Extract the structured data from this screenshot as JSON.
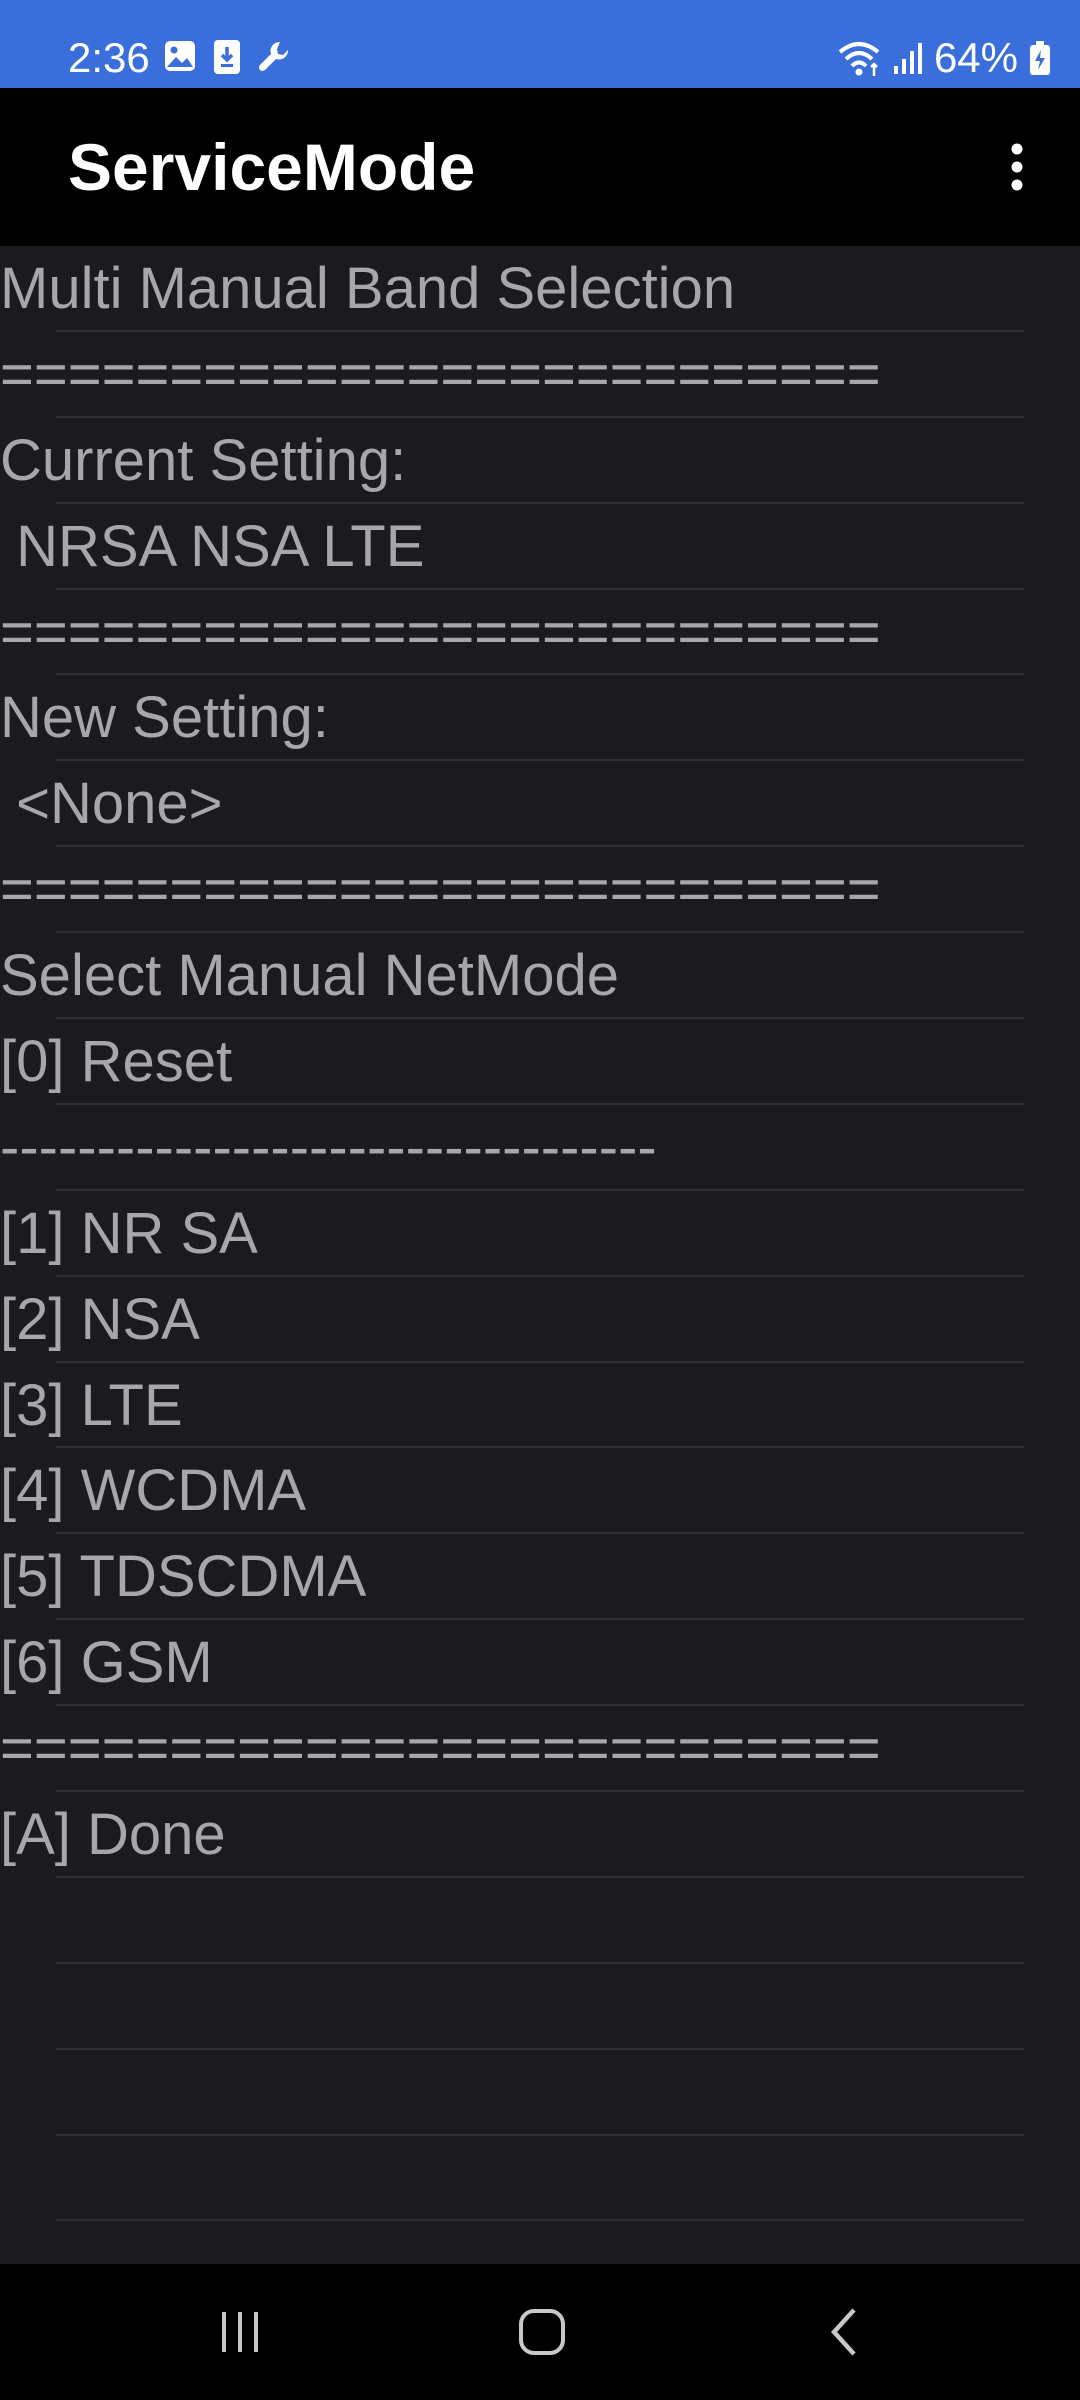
{
  "status_bar": {
    "time": "2:36",
    "battery": "64%",
    "color": "#3a6fdb"
  },
  "app_bar": {
    "title": "ServiceMode"
  },
  "lines": [
    "Multi Manual Band Selection",
    "==========================",
    "Current Setting:",
    " NRSA NSA LTE",
    "==========================",
    "New Setting:",
    " <None>",
    "==========================",
    "Select Manual NetMode",
    "[0] Reset",
    "----------------------------------",
    "[1] NR SA",
    "[2] NSA",
    "[3] LTE",
    "[4] WCDMA",
    "[5] TDSCDMA",
    "[6] GSM",
    "==========================",
    "[A] Done",
    "",
    "",
    "",
    "",
    ""
  ]
}
